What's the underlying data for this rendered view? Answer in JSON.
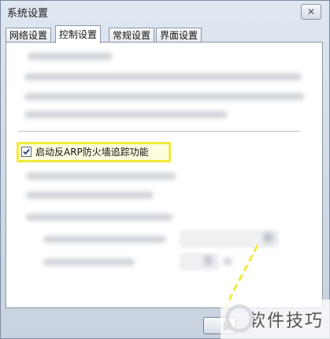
{
  "window": {
    "title": "系统设置",
    "close_symbol": "✕"
  },
  "tabs": [
    {
      "label": "网络设置",
      "active": false
    },
    {
      "label": "控制设置",
      "active": true
    },
    {
      "label": "常规设置",
      "active": false
    },
    {
      "label": "界面设置",
      "active": false
    }
  ],
  "control": {
    "arp_firewall_checkbox": {
      "label": "启动反ARP防火墙追踪功能",
      "checked": true
    }
  },
  "buttons": {
    "ok_label": "确"
  },
  "watermark": {
    "text": "软件技巧"
  },
  "colors": {
    "highlight": "#f2ea3c",
    "arrow": "#f2ea3c"
  },
  "icons": {
    "close": "close-icon",
    "check": "check-icon",
    "dropdown": "chevron-down-icon",
    "spin": "spinner-arrows-icon"
  }
}
